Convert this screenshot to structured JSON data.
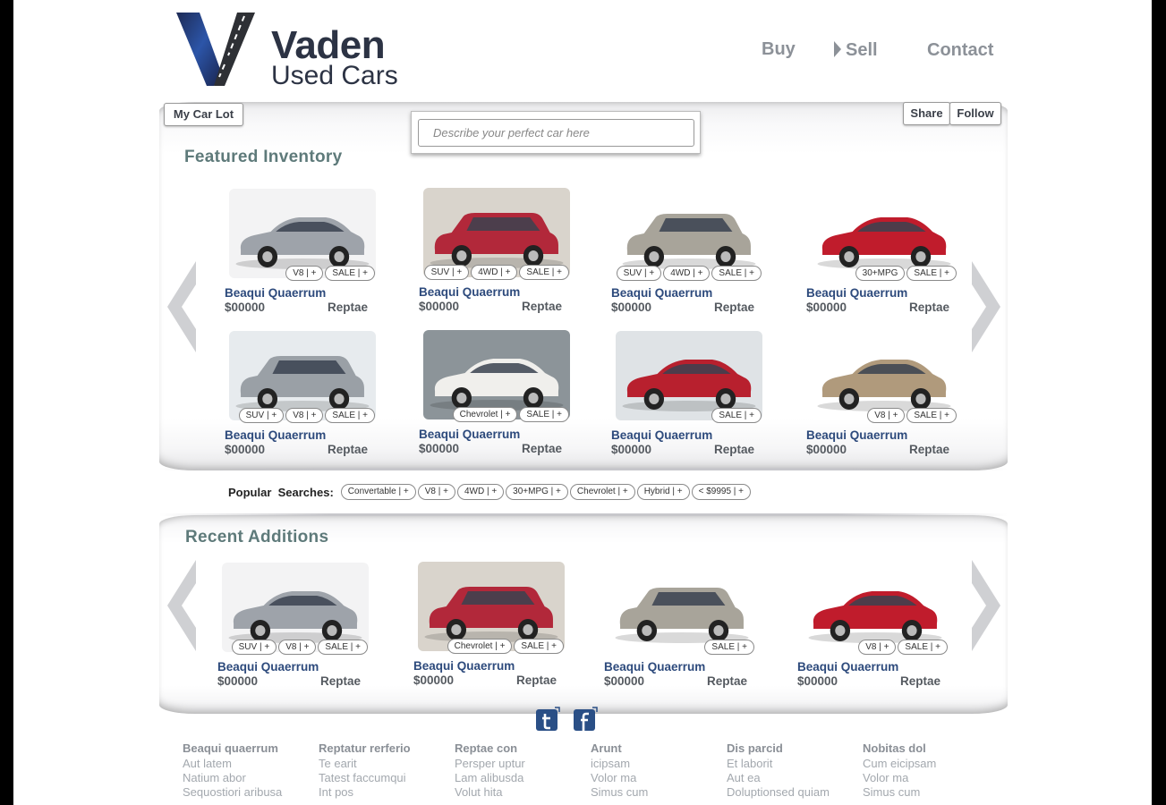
{
  "brand": {
    "line1": "Vaden",
    "line2": "Used Cars"
  },
  "nav": {
    "buy": "Buy",
    "sell": "Sell",
    "contact": "Contact"
  },
  "toolbar": {
    "my_car_lot": "My Car Lot",
    "share": "Share",
    "follow": "Follow"
  },
  "search": {
    "placeholder": "Describe your perfect car here"
  },
  "featured": {
    "title": "Featured Inventory",
    "cars": [
      {
        "name": "Beaqui Quaerrum",
        "price": "$00000",
        "location": "Reptae",
        "tags": [
          "V8 | +",
          "SALE | +"
        ]
      },
      {
        "name": "Beaqui Quaerrum",
        "price": "$00000",
        "location": "Reptae",
        "tags": [
          "SUV | +",
          "4WD | +",
          "SALE | +"
        ]
      },
      {
        "name": "Beaqui Quaerrum",
        "price": "$00000",
        "location": "Reptae",
        "tags": [
          "SUV | +",
          "4WD | +",
          "SALE | +"
        ]
      },
      {
        "name": "Beaqui Quaerrum",
        "price": "$00000",
        "location": "Reptae",
        "tags": [
          "30+MPG",
          "SALE | +"
        ]
      },
      {
        "name": "Beaqui Quaerrum",
        "price": "$00000",
        "location": "Reptae",
        "tags": [
          "SUV | +",
          "V8 | +",
          "SALE | +"
        ]
      },
      {
        "name": "Beaqui Quaerrum",
        "price": "$00000",
        "location": "Reptae",
        "tags": [
          "Chevrolet | +",
          "SALE | +"
        ]
      },
      {
        "name": "Beaqui Quaerrum",
        "price": "$00000",
        "location": "Reptae",
        "tags": [
          "SALE | +"
        ]
      },
      {
        "name": "Beaqui Quaerrum",
        "price": "$00000",
        "location": "Reptae",
        "tags": [
          "V8 | +",
          "SALE | +"
        ]
      }
    ]
  },
  "popular": {
    "label": "Popular  Searches:",
    "tags": [
      "Convertable | +",
      "V8 | +",
      "4WD | +",
      "30+MPG | +",
      "Chevrolet | +",
      "Hybrid | +",
      "< $9995 | +"
    ]
  },
  "recent": {
    "title": "Recent Additions",
    "cars": [
      {
        "name": "Beaqui Quaerrum",
        "price": "$00000",
        "location": "Reptae",
        "tags": [
          "SUV | +",
          "V8 | +",
          "SALE | +"
        ]
      },
      {
        "name": "Beaqui Quaerrum",
        "price": "$00000",
        "location": "Reptae",
        "tags": [
          "Chevrolet | +",
          "SALE | +"
        ]
      },
      {
        "name": "Beaqui Quaerrum",
        "price": "$00000",
        "location": "Reptae",
        "tags": [
          "SALE | +"
        ]
      },
      {
        "name": "Beaqui Quaerrum",
        "price": "$00000",
        "location": "Reptae",
        "tags": [
          "V8 | +",
          "SALE | +"
        ]
      }
    ]
  },
  "footer": {
    "columns": [
      {
        "heading": "Beaqui quaerrum",
        "links": [
          "Aut latem",
          "Natium abor",
          "Sequostiori aribusa"
        ]
      },
      {
        "heading": "Reptatur rerferio",
        "links": [
          "Te earit",
          "Tatest faccumqui",
          "Int pos"
        ]
      },
      {
        "heading": "Reptae con",
        "links": [
          "Persper uptur",
          "Lam alibusda",
          "Volut hita"
        ]
      },
      {
        "heading": "Arunt",
        "links": [
          "icipsam",
          "Volor ma",
          "Simus cum"
        ]
      },
      {
        "heading": "Dis parcid",
        "links": [
          "Et laborit",
          "Aut ea",
          "Doluptionsed quiam"
        ]
      },
      {
        "heading": "Nobitas dol",
        "links": [
          "Cum eicipsam",
          "Volor ma",
          "Simus cum"
        ]
      }
    ]
  },
  "colors": {
    "accent_blue": "#2d4a7c",
    "title_teal": "#5e7a7a",
    "brand_dark": "#2c3344"
  },
  "icons": {
    "twitter": "twitter-icon",
    "facebook": "facebook-icon"
  }
}
